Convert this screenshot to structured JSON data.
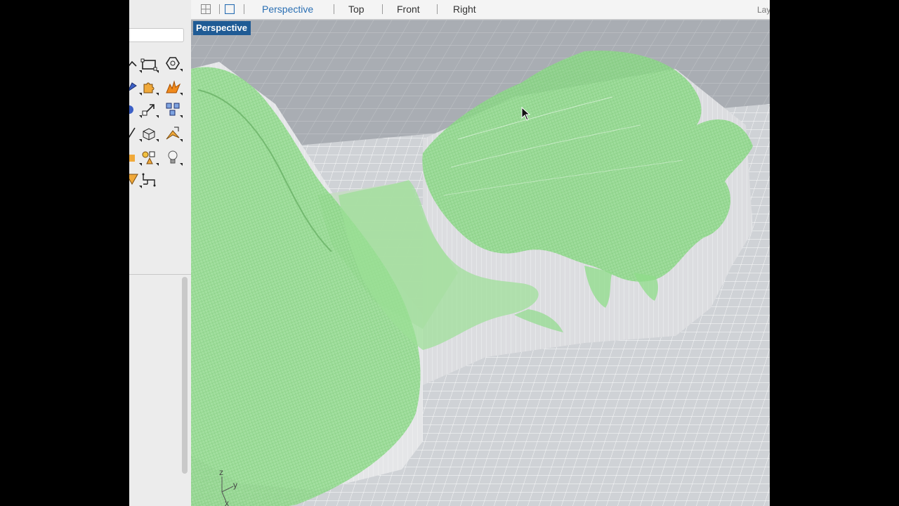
{
  "viewbar": {
    "tabs": [
      "Perspective",
      "Top",
      "Front",
      "Right"
    ],
    "active_tab": "Perspective",
    "layers_label": "Lay"
  },
  "viewport": {
    "label": "Perspective",
    "axis": {
      "z": "z",
      "y": "y",
      "x": "x"
    }
  },
  "sidebar": {
    "tools": [
      "curve-from-2-views-icon",
      "rectangle-icon",
      "polygon-icon",
      "surface-tools-icon",
      "puzzle-piece-icon",
      "explode-icon",
      "sweep-icon",
      "scale-icon",
      "array-icon",
      "line-icon",
      "solid-box-icon",
      "extrude-icon",
      "transform-icon",
      "group-icon",
      "light-bulb-icon",
      "render-icon",
      "dimension-icon"
    ]
  },
  "colors": {
    "accent": "#2a6fb3",
    "viewport_label_bg": "#1f5b95",
    "terrain": "#8fdc8a",
    "grid": "#ffffff",
    "viewport_bg": "#a9adb3"
  }
}
